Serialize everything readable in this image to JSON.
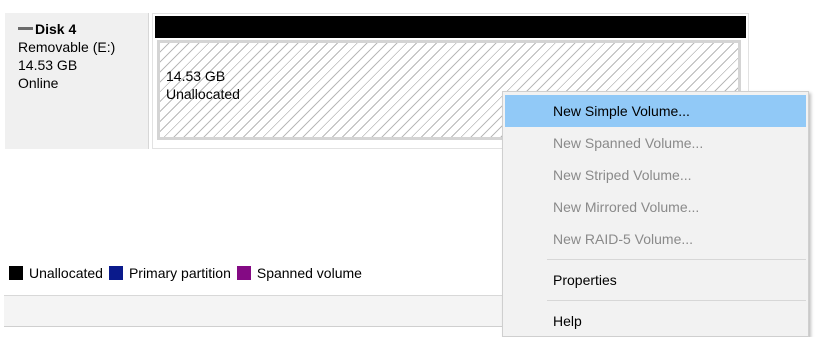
{
  "disk": {
    "name": "Disk 4",
    "type": "Removable (E:)",
    "size": "14.53 GB",
    "status": "Online",
    "icon": "disk-drive-icon"
  },
  "partition": {
    "size": "14.53 GB",
    "state": "Unallocated"
  },
  "legend": [
    {
      "label": "Unallocated",
      "color": "#000000"
    },
    {
      "label": "Primary partition",
      "color": "#0a1a8c"
    },
    {
      "label": "Spanned volume",
      "color": "#840a84"
    }
  ],
  "context_menu": {
    "items": [
      {
        "label": "New Simple Volume...",
        "enabled": true,
        "highlighted": true
      },
      {
        "label": "New Spanned Volume...",
        "enabled": false
      },
      {
        "label": "New Striped Volume...",
        "enabled": false
      },
      {
        "label": "New Mirrored Volume...",
        "enabled": false
      },
      {
        "label": "New RAID-5 Volume...",
        "enabled": false
      },
      {
        "label": "Properties",
        "enabled": true
      },
      {
        "label": "Help",
        "enabled": true
      }
    ]
  }
}
